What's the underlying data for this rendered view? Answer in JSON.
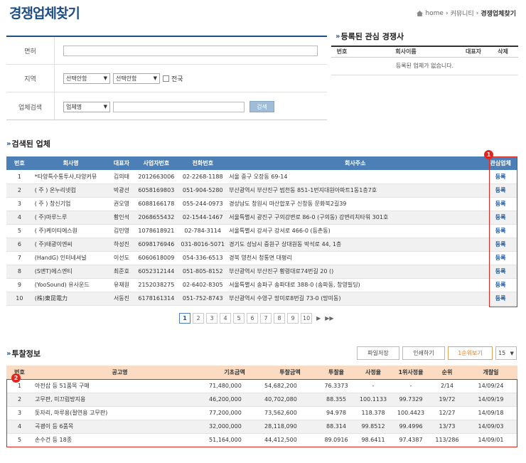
{
  "page": {
    "title": "경쟁업체찾기"
  },
  "breadcrumb": {
    "home": "home",
    "sep": ">",
    "community": "커뮤니티",
    "current": "경쟁업체찾기"
  },
  "search_form": {
    "license_label": "면허",
    "region_label": "지역",
    "region_select1": "선택안함",
    "region_select2": "선택안함",
    "nationwide_label": "전국",
    "company_search_label": "업체검색",
    "search_type": "업체명",
    "search_value": "",
    "search_button": "검색"
  },
  "watchlist": {
    "heading": "등록된 관심 경쟁사",
    "columns": [
      "번호",
      "회사이름",
      "대표자",
      "삭제"
    ],
    "empty_message": "등록된 업체가 없습니다."
  },
  "found": {
    "heading": "검색된 업체",
    "columns": [
      "번호",
      "회사명",
      "대표자",
      "사업자번호",
      "전화번호",
      "회사주소",
      "관심업체"
    ],
    "rows": [
      {
        "no": "1",
        "name": "*타양특수통투사,타양커뮤",
        "ceo": "김의태",
        "biz": "2012663006",
        "tel": "02-2268-1188",
        "addr": "서울 중구 오장동 69-14",
        "action": "등록"
      },
      {
        "no": "2",
        "name": "( 주 ) 온누리넷컴",
        "ceo": "박광선",
        "biz": "6058169803",
        "tel": "051-904-5280",
        "addr": "부산광역시 부산진구 범천동 851-1번지대원아파트1동1층7호",
        "action": "등록"
      },
      {
        "no": "3",
        "name": "( 주 ) 창신기업",
        "ceo": "권오영",
        "biz": "6088166178",
        "tel": "055-244-0973",
        "addr": "경상남도 창원시 마산합포구 신창동 문화북2길39",
        "action": "등록"
      },
      {
        "no": "4",
        "name": "( 주)마루느루",
        "ceo": "황인석",
        "biz": "2068655432",
        "tel": "02-1544-1467",
        "addr": "서울특별시 광진구 구의강변로 86-0 (구의동) 강변리치타워 301호",
        "action": "등록"
      },
      {
        "no": "5",
        "name": "( 주)케이티에스원",
        "ceo": "김민영",
        "biz": "1078618921",
        "tel": "02-784-3114",
        "addr": "서울특별시 강서구 강서로 466-0 (등촌동)",
        "action": "등록"
      },
      {
        "no": "6",
        "name": "( 주)태광이엔씨",
        "ceo": "하성진",
        "biz": "6098176946",
        "tel": "031-8016-5071",
        "addr": "경기도 성남시 중원구 상대원동 박석로 44, 1층",
        "action": "등록"
      },
      {
        "no": "7",
        "name": "(HandG) 인터네셔널",
        "ceo": "이선도",
        "biz": "6060618009",
        "tel": "054-336-6513",
        "addr": "경북 영천시 청통면 대평리",
        "action": "등록"
      },
      {
        "no": "8",
        "name": "(S앤T)에스엔티",
        "ceo": "최준호",
        "biz": "6052312144",
        "tel": "051-805-8152",
        "addr": "부산광역시 부산진구 황령대로74번길 20 ()",
        "action": "등록"
      },
      {
        "no": "9",
        "name": "(YooSound) 유사운드",
        "ceo": "유재원",
        "biz": "2152038275",
        "tel": "02-6402-8305",
        "addr": "서울특별시 송파구 송파대로 388-0 (송파동, 창영빌딩)",
        "action": "등록"
      },
      {
        "no": "10",
        "name": "(株)東昆電力",
        "ceo": "서동진",
        "biz": "6178161314",
        "tel": "051-752-8743",
        "addr": "부산광역시 수영구 망미로8번길 73-0 (망미동)",
        "action": "등록"
      }
    ],
    "badge": "1"
  },
  "pager": {
    "pages": [
      "1",
      "2",
      "3",
      "4",
      "5",
      "6",
      "7",
      "8",
      "9",
      "10"
    ],
    "current": "1",
    "next": "▶",
    "last": "▶▶"
  },
  "bid": {
    "heading": "투찰정보",
    "buttons": {
      "file_save": "파일저장",
      "print": "인쇄하기",
      "first_rank": "1순위보기",
      "per_page": "15"
    },
    "columns": [
      "번호",
      "공고명",
      "기초금액",
      "투찰금액",
      "투찰율",
      "사정율",
      "1위사정율",
      "순위",
      "개찰일"
    ],
    "rows": [
      {
        "no": "1",
        "title": "아전삽 등 51품목 구매",
        "base": "71,480,000",
        "bid": "54,682,200",
        "rate": "76.3373",
        "adj": "-",
        "first": "-",
        "rank": "2/14",
        "date": "14/09/24"
      },
      {
        "no": "2",
        "title": "고무판, 미끄럼방지용",
        "base": "46,200,000",
        "bid": "40,702,080",
        "rate": "88.355",
        "adj": "100.1133",
        "first": "99.7329",
        "rank": "19/72",
        "date": "14/09/19"
      },
      {
        "no": "3",
        "title": "돗자리, 마루용(절연용 고무판)",
        "base": "77,200,000",
        "bid": "73,562,600",
        "rate": "94.978",
        "adj": "118.378",
        "first": "100.4423",
        "rank": "12/27",
        "date": "14/09/18"
      },
      {
        "no": "4",
        "title": "곡괭이 등 6품목",
        "base": "32,000,000",
        "bid": "28,118,090",
        "rate": "88.314",
        "adj": "99.8512",
        "first": "99.4996",
        "rank": "13/73",
        "date": "14/09/03"
      },
      {
        "no": "5",
        "title": "손수건 등 18종",
        "base": "51,164,000",
        "bid": "44,412,500",
        "rate": "89.0916",
        "adj": "98.6411",
        "first": "97.4387",
        "rank": "113/286",
        "date": "14/09/01"
      }
    ],
    "badge": "2"
  }
}
